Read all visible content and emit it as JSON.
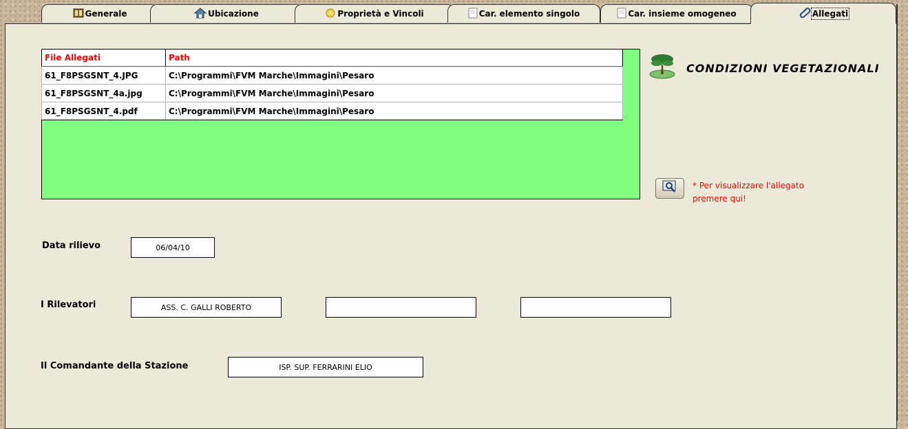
{
  "tabs": [
    {
      "label": "Generale",
      "icon": "grid-icon"
    },
    {
      "label": "Ubicazione",
      "icon": "house-icon"
    },
    {
      "label": "Proprietà e Vincoli",
      "icon": "coins-icon"
    },
    {
      "label": "Car. elemento singolo",
      "icon": "document-icon"
    },
    {
      "label": "Car. insieme omogeneo",
      "icon": "document-icon"
    },
    {
      "label": "Allegati",
      "icon": "paperclip-icon",
      "active": true
    }
  ],
  "attachments": {
    "columns": [
      "File Allegati",
      "Path"
    ],
    "rows": [
      [
        "61_F8PSGSNT_4.JPG",
        "C:\\Programmi\\FVM Marche\\Immagini\\Pesaro"
      ],
      [
        "61_F8PSGSNT_4a.jpg",
        "C:\\Programmi\\FVM Marche\\Immagini\\Pesaro"
      ],
      [
        "61_F8PSGSNT_4.pdf",
        "C:\\Programmi\\FVM Marche\\Immagini\\Pesaro"
      ]
    ]
  },
  "header": {
    "title": "CONDIZIONI VEGETAZIONALI",
    "icon": "tree-icon"
  },
  "view_hint": {
    "line1": "* Per visualizzare l'allegato",
    "line2": "premere qui!",
    "button_icon": "magnifier-icon"
  },
  "form": {
    "data_rilievo_label": "Data rilievo",
    "data_rilievo_value": "06/04/10",
    "rilevatori_label": "I Rilevatori",
    "rilevatori_values": [
      "ASS. C. GALLI ROBERTO",
      "",
      ""
    ],
    "comandante_label": "Il Comandante della Stazione",
    "comandante_value": "ISP. SUP. FERRARINI ELIO"
  },
  "colors": {
    "grid_fill": "#80ff80",
    "header_text": "#ff0000",
    "hint_text": "#ff0000",
    "panel_bg": "#ece9d8"
  }
}
